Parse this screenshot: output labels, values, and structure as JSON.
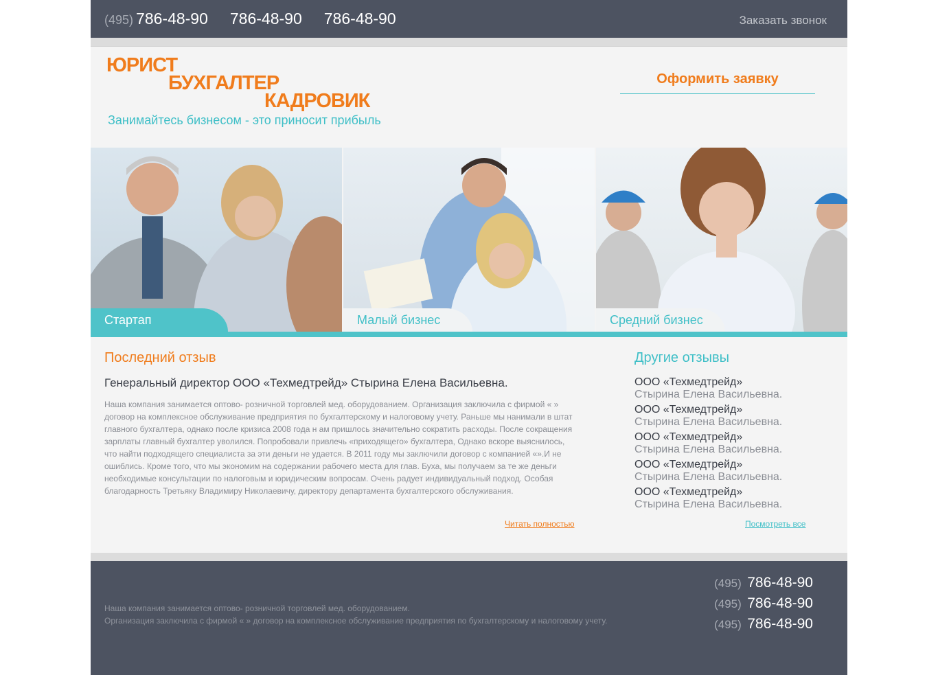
{
  "topbar": {
    "phone_code": "(495)",
    "phones": [
      "786-48-90",
      "786-48-90",
      "786-48-90"
    ],
    "callback": "Заказать звонок"
  },
  "header": {
    "logo_lines": [
      "ЮРИСТ",
      "БУХГАЛТЕР",
      "КАДРОВИК"
    ],
    "slogan": "Занимайтесь бизнесом - это приносит прибыль",
    "order_button": "Оформить заявку"
  },
  "banner": {
    "tabs": [
      "Стартап",
      "Малый бизнес",
      "Средний бизнес"
    ],
    "active_tab": 0
  },
  "latest_review": {
    "heading": "Последний отзыв",
    "title": "Генеральный директор ООО «Техмедтрейд» Стырина Елена Васильевна.",
    "text": "Наша компания занимается оптово- розничной торговлей мед. оборудованием. Организация заключила с фирмой « » договор на комплексное обслуживание предприятия по бухгалтерскому и налоговому учету. Раньше мы нанимали в штат главного бухгалтера, однако после кризиса 2008 года н ам пришлось значительно сократить расходы. После сокращения зарплаты главный бухгалтер уволился. Попробовали привлечь «приходящего» бухгалтера, Однако вскоре выяснилось, что найти подходящего специалиста за эти деньги не удается. В 2011 году мы заключили договор с компанией «».И не ошиблись. Кроме того, что мы экономим на содержании рабочего места для глав. Буха, мы получаем за те же деньги необходимые консультации по налоговым и юридическим вопросам. Очень радует индивидуальный подход. Особая благодарность Третьяку Владимиру Николаевичу, директору департамента бухгалтерского обслуживания.",
    "read_more": "Читать полностью"
  },
  "other_reviews": {
    "heading": "Другие отзывы",
    "items": [
      {
        "company": "ООО «Техмедтрейд»",
        "person": "Стырина Елена Васильевна."
      },
      {
        "company": "ООО «Техмедтрейд»",
        "person": "Стырина Елена Васильевна."
      },
      {
        "company": "ООО «Техмедтрейд»",
        "person": "Стырина Елена Васильевна."
      },
      {
        "company": "ООО «Техмедтрейд»",
        "person": "Стырина Елена Васильевна."
      },
      {
        "company": "ООО «Техмедтрейд»",
        "person": "Стырина Елена Васильевна."
      }
    ],
    "see_all": "Посмотреть все"
  },
  "footer": {
    "text_line1": "Наша компания занимается оптово- розничной торговлей мед. оборудованием.",
    "text_line2": "Организация заключила с фирмой « » договор на комплексное обслуживание предприятия по бухгалтерскому и налоговому учету.",
    "phone_code": "(495)",
    "phones": [
      "786-48-90",
      "786-48-90",
      "786-48-90"
    ]
  },
  "colors": {
    "accent_orange": "#f07c1c",
    "accent_teal": "#4fc3c9",
    "dark_bar": "#4d5361"
  }
}
